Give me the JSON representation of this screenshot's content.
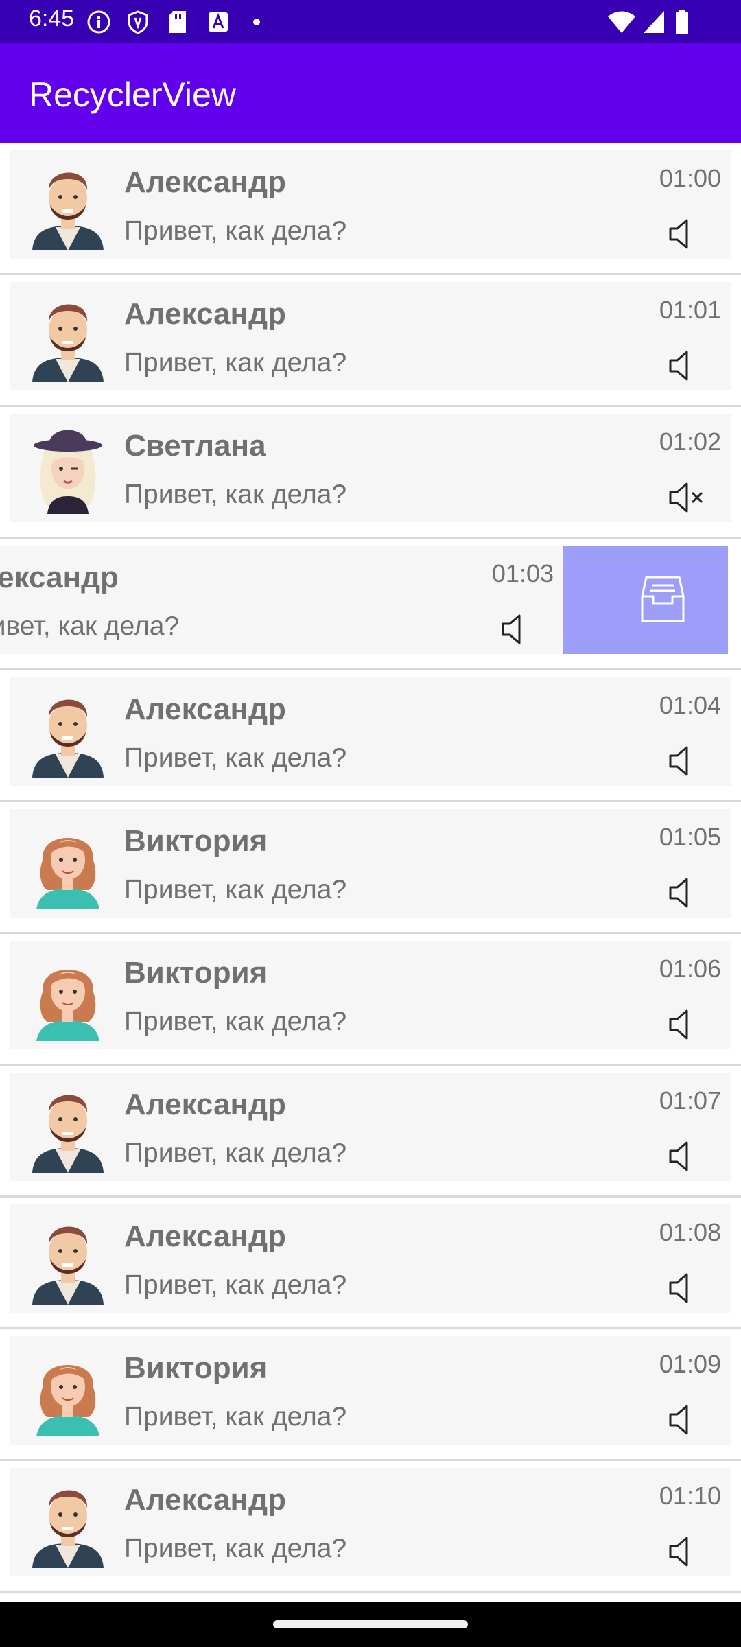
{
  "status_bar": {
    "time": "6:45",
    "left_icons": [
      "info-icon",
      "shield-icon",
      "sd-card-icon",
      "translate-icon",
      "dot-icon"
    ],
    "right_icons": [
      "wifi-icon",
      "signal-icon",
      "battery-icon"
    ]
  },
  "app_bar": {
    "title": "RecyclerView"
  },
  "colors": {
    "status_bar": "#3700B3",
    "app_bar": "#6200EE",
    "card": "#f6f6f6",
    "text": "#707070",
    "archive": "#9c9ef9"
  },
  "list": {
    "items": [
      {
        "name": "Александр",
        "message": "Привет, как дела?",
        "time": "01:00",
        "avatar": "man",
        "muted": false,
        "swiped": false
      },
      {
        "name": "Александр",
        "message": "Привет, как дела?",
        "time": "01:01",
        "avatar": "man",
        "muted": false,
        "swiped": false
      },
      {
        "name": "Светлана",
        "message": "Привет, как дела?",
        "time": "01:02",
        "avatar": "woman-hat",
        "muted": true,
        "swiped": false
      },
      {
        "name": "Александр",
        "message": "Привет, как дела?",
        "time": "01:03",
        "avatar": "man",
        "muted": false,
        "swiped": true
      },
      {
        "name": "Александр",
        "message": "Привет, как дела?",
        "time": "01:04",
        "avatar": "man",
        "muted": false,
        "swiped": false
      },
      {
        "name": "Виктория",
        "message": "Привет, как дела?",
        "time": "01:05",
        "avatar": "woman",
        "muted": false,
        "swiped": false
      },
      {
        "name": "Виктория",
        "message": "Привет, как дела?",
        "time": "01:06",
        "avatar": "woman",
        "muted": false,
        "swiped": false
      },
      {
        "name": "Александр",
        "message": "Привет, как дела?",
        "time": "01:07",
        "avatar": "man",
        "muted": false,
        "swiped": false
      },
      {
        "name": "Александр",
        "message": "Привет, как дела?",
        "time": "01:08",
        "avatar": "man",
        "muted": false,
        "swiped": false
      },
      {
        "name": "Виктория",
        "message": "Привет, как дела?",
        "time": "01:09",
        "avatar": "woman",
        "muted": false,
        "swiped": false
      },
      {
        "name": "Александр",
        "message": "Привет, как дела?",
        "time": "01:10",
        "avatar": "man",
        "muted": false,
        "swiped": false
      }
    ],
    "swipe_action_icon": "archive-icon"
  }
}
